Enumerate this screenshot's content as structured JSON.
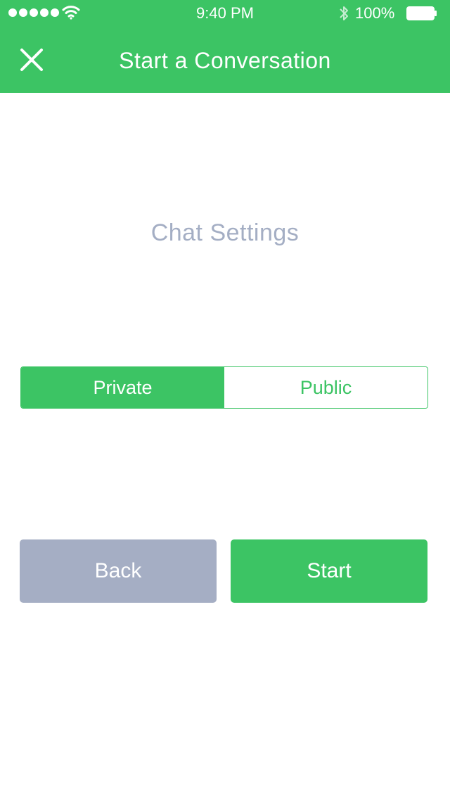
{
  "colors": {
    "accent": "#3cc464",
    "muted": "#a5aec4",
    "background": "#ffffff",
    "on_accent": "#ffffff"
  },
  "status_bar": {
    "time": "9:40 PM",
    "battery_percent": "100%",
    "icons": [
      "signal-dots-icon",
      "wifi-icon",
      "bluetooth-icon",
      "battery-icon"
    ]
  },
  "nav": {
    "title": "Start a Conversation",
    "close_icon": "close-icon"
  },
  "content": {
    "section_title": "Chat Settings",
    "visibility_toggle": {
      "options": [
        "Private",
        "Public"
      ],
      "selected": "Private"
    }
  },
  "actions": {
    "back_label": "Back",
    "start_label": "Start"
  }
}
